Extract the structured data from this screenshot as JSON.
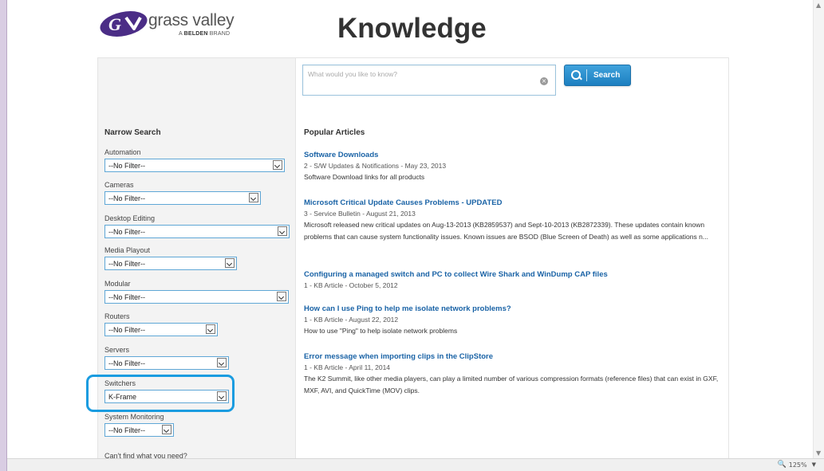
{
  "header": {
    "brand_name": "grass valley",
    "brand_sub_prefix": "A ",
    "brand_sub_bold": "BELDEN",
    "brand_sub_suffix": " BRAND",
    "page_title": "Knowledge"
  },
  "search": {
    "placeholder": "What would you like to know?",
    "value": "",
    "clear_symbol": "×",
    "button_label": "Search"
  },
  "sidebar": {
    "title": "Narrow Search",
    "filters": [
      {
        "label": "Automation",
        "value": "--No Filter--"
      },
      {
        "label": "Cameras",
        "value": "--No Filter--"
      },
      {
        "label": "Desktop Editing",
        "value": "--No Filter--"
      },
      {
        "label": "Media Playout",
        "value": "--No Filter--"
      },
      {
        "label": "Modular",
        "value": "--No Filter--"
      },
      {
        "label": "Routers",
        "value": "--No Filter--"
      },
      {
        "label": "Servers",
        "value": "--No Filter--"
      },
      {
        "label": "Switchers",
        "value": "K-Frame"
      },
      {
        "label": "System Monitoring",
        "value": "--No Filter--"
      }
    ],
    "cant_find": "Can't find what you need?"
  },
  "main": {
    "popular_title": "Popular Articles",
    "articles": [
      {
        "title": "Software Downloads",
        "meta": "2 - S/W Updates & Notifications - May 23, 2013",
        "description": "Software Download links for all products"
      },
      {
        "title": "Microsoft Critical Update Causes Problems - UPDATED",
        "meta": "3 - Service Bulletin - August 21, 2013",
        "description": "Microsoft released new critical updates on Aug-13-2013 (KB2859537) and Sept-10-2013 (KB2872339). These updates contain known problems that can cause system functionality issues. Known issues are BSOD (Blue Screen of Death) as well as some applications n..."
      },
      {
        "title": "Configuring a managed switch and PC to collect Wire Shark and WinDump CAP files",
        "meta": "1 - KB Article - October 5, 2012",
        "description": ""
      },
      {
        "title": "How can I use Ping to help me isolate network problems?",
        "meta": "1 - KB Article - August 22, 2012",
        "description": "How to use \"Ping\" to help isolate network problems"
      },
      {
        "title": "Error message when importing clips in the ClipStore",
        "meta": "1 - KB Article - April 11, 2014",
        "description": "The K2 Summit, like other media players, can play a limited number of various compression formats (reference files) that can exist in GXF, MXF, AVI, and QuickTime (MOV) clips."
      }
    ]
  },
  "statusbar": {
    "zoom": "125%"
  },
  "colors": {
    "link": "#1a63a6",
    "accent": "#1a9ce0",
    "brand_purple": "#4b2d86"
  },
  "icons": [
    "grass-valley-logo",
    "search-icon",
    "clear-icon",
    "chevron-down-icon",
    "zoom-icon"
  ]
}
